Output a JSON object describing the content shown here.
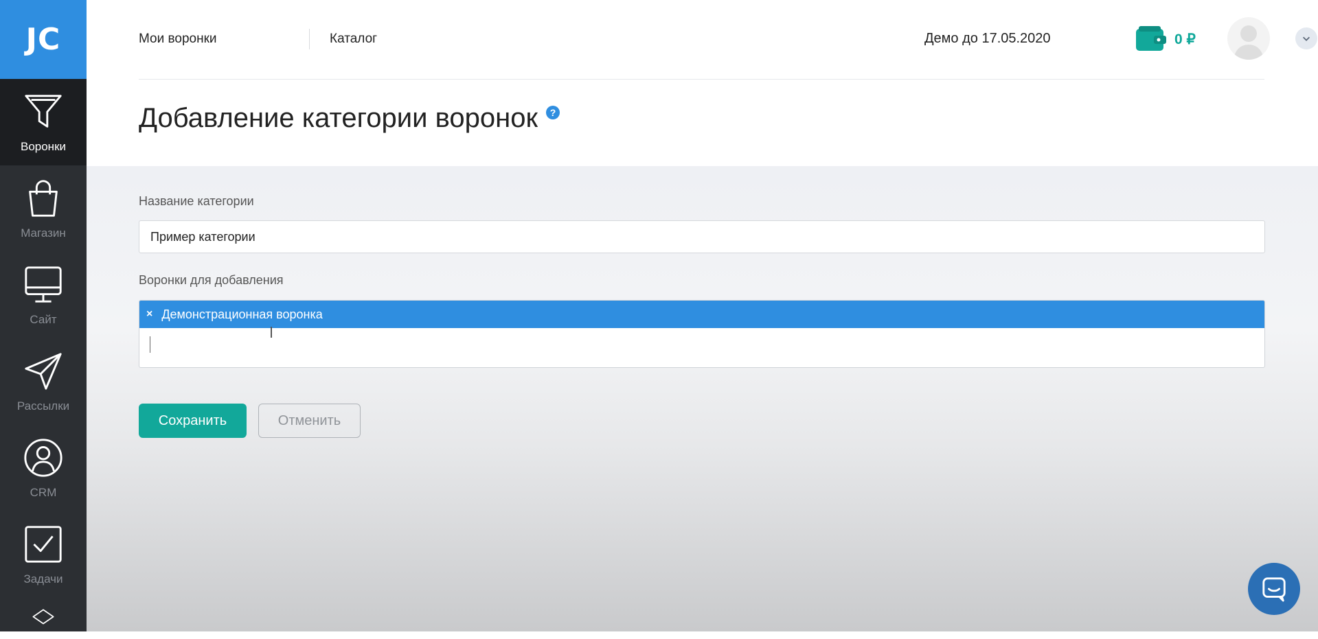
{
  "logo": {
    "text": "JC"
  },
  "sidebar": {
    "items": [
      {
        "label": "Воронки",
        "icon": "funnel-icon",
        "active": true
      },
      {
        "label": "Магазин",
        "icon": "shopping-bag-icon",
        "active": false
      },
      {
        "label": "Сайт",
        "icon": "monitor-icon",
        "active": false
      },
      {
        "label": "Рассылки",
        "icon": "paper-plane-icon",
        "active": false
      },
      {
        "label": "CRM",
        "icon": "user-circle-icon",
        "active": false
      },
      {
        "label": "Задачи",
        "icon": "checkbox-icon",
        "active": false
      },
      {
        "label": "",
        "icon": "layers-icon",
        "active": false
      }
    ]
  },
  "topnav": {
    "links": [
      "Мои воронки",
      "Каталог"
    ],
    "demo_text": "Демо до 17.05.2020",
    "balance": "0 ₽"
  },
  "page": {
    "title": "Добавление категории воронок",
    "help_icon": "?"
  },
  "form": {
    "category_label": "Название категории",
    "category_value": "Пример категории",
    "funnels_label": "Воронки для добавления",
    "selected_funnels": [
      {
        "label": "Демонстрационная воронка",
        "remove": "×"
      }
    ]
  },
  "buttons": {
    "save": "Сохранить",
    "cancel": "Отменить"
  },
  "colors": {
    "accent": "#2f8ee0",
    "success": "#12a89a",
    "sidebar": "#2c2f33"
  }
}
